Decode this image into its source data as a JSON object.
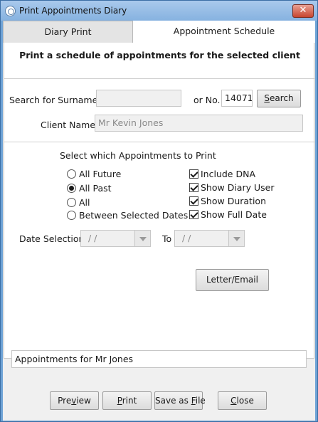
{
  "window": {
    "title": "Print Appointments Diary",
    "close_label": "✕"
  },
  "tabs": [
    {
      "label": "Diary Print",
      "selected": false
    },
    {
      "label": "Appointment Schedule",
      "selected": true
    }
  ],
  "heading": "Print a schedule of appointments for the selected client",
  "search": {
    "surname_label": "Search for Surname",
    "surname_value": "",
    "or_no_label": "or No.",
    "number_value": "14071",
    "button_pre": "",
    "button_key": "S",
    "button_post": "earch"
  },
  "client": {
    "label": "Client Name",
    "value": "Mr Kevin Jones"
  },
  "select": {
    "title": "Select which Appointments to Print",
    "radios": [
      {
        "label": "All Future",
        "checked": false
      },
      {
        "label": "All Past",
        "checked": true
      },
      {
        "label": "All",
        "checked": false
      },
      {
        "label": "Between Selected Dates",
        "checked": false
      }
    ],
    "checks": [
      {
        "label": "Include DNA",
        "checked": true
      },
      {
        "label": "Show Diary User",
        "checked": true
      },
      {
        "label": "Show Duration",
        "checked": true
      },
      {
        "label": "Show Full Date",
        "checked": true
      }
    ]
  },
  "dates": {
    "selection_label": "Date Selection",
    "from_value": "/  /",
    "to_label": "To",
    "to_value": "/  /"
  },
  "letter_button": "Letter/Email",
  "footer_text": "Appointments for Mr Jones",
  "buttons": {
    "preview": {
      "pre": "Pre",
      "key": "v",
      "post": "iew"
    },
    "print": {
      "pre": "",
      "key": "P",
      "post": "rint"
    },
    "save": {
      "pre": "Save as ",
      "key": "F",
      "post": "ile"
    },
    "close": {
      "pre": "",
      "key": "C",
      "post": "lose"
    }
  },
  "colors": {
    "title_bar": "#86b2e0",
    "frame": "#6fa3d6",
    "close_button": "#c7452f"
  }
}
